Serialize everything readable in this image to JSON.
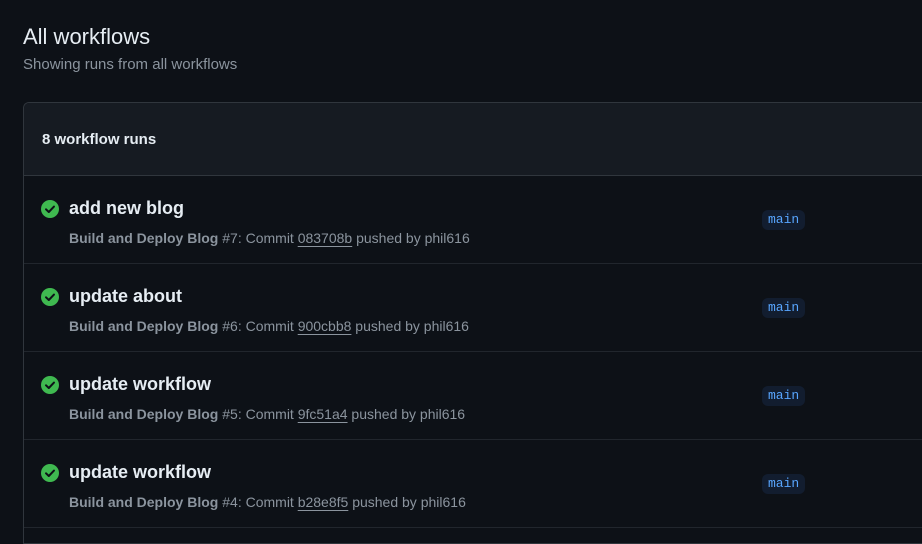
{
  "header": {
    "title": "All workflows",
    "subtitle": "Showing runs from all workflows"
  },
  "runs_panel": {
    "count_label": "8 workflow runs",
    "status_color": "#3fb950",
    "runs": [
      {
        "title": "add new blog",
        "workflow": "Build and Deploy Blog",
        "run_number": "#7",
        "commit_prefix": ": Commit ",
        "sha": "083708b",
        "pushed_by": " pushed by phil616",
        "branch": "main",
        "status_icon": "check-circle-icon"
      },
      {
        "title": "update about",
        "workflow": "Build and Deploy Blog",
        "run_number": "#6",
        "commit_prefix": ": Commit ",
        "sha": "900cbb8",
        "pushed_by": " pushed by phil616",
        "branch": "main",
        "status_icon": "check-circle-icon"
      },
      {
        "title": "update workflow",
        "workflow": "Build and Deploy Blog",
        "run_number": "#5",
        "commit_prefix": ": Commit ",
        "sha": "9fc51a4",
        "pushed_by": " pushed by phil616",
        "branch": "main",
        "status_icon": "check-circle-icon"
      },
      {
        "title": "update workflow",
        "workflow": "Build and Deploy Blog",
        "run_number": "#4",
        "commit_prefix": ": Commit ",
        "sha": "b28e8f5",
        "pushed_by": " pushed by phil616",
        "branch": "main",
        "status_icon": "check-circle-icon"
      }
    ]
  }
}
